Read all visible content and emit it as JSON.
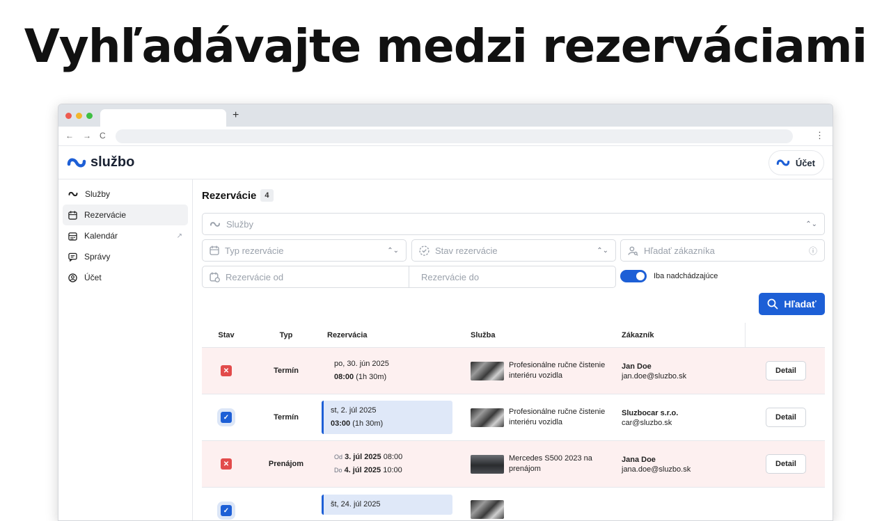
{
  "headline": "Vyhľadávajte medzi rezerváciami",
  "browser": {
    "new_tab": "+",
    "menu": "⋮",
    "nav_back": "←",
    "nav_forward": "→",
    "nav_reload": "C"
  },
  "app": {
    "brand": "službo",
    "account_label": "Účet",
    "brand_color": "#1d5fd6"
  },
  "sidebar": {
    "items": [
      {
        "label": "Služby",
        "icon": "wave-icon"
      },
      {
        "label": "Rezervácie",
        "icon": "calendar-icon",
        "active": true
      },
      {
        "label": "Kalendár",
        "icon": "calendar-grid-icon",
        "external": true
      },
      {
        "label": "Správy",
        "icon": "message-icon"
      },
      {
        "label": "Účet",
        "icon": "user-circle-icon"
      }
    ]
  },
  "main": {
    "title": "Rezervácie",
    "count": "4",
    "filters": {
      "services_placeholder": "Služby",
      "type_placeholder": "Typ rezervácie",
      "status_placeholder": "Stav rezervácie",
      "customer_placeholder": "Hľadať zákazníka",
      "from_placeholder": "Rezervácie od",
      "to_placeholder": "Rezervácie do",
      "upcoming_label": "Iba nadchádzajúce",
      "upcoming_on": true,
      "search_label": "Hľadať"
    },
    "table": {
      "headers": {
        "stav": "Stav",
        "typ": "Typ",
        "rezervacia": "Rezervácia",
        "sluzba": "Služba",
        "zakaznik": "Zákazník"
      },
      "detail_label": "Detail",
      "rows": [
        {
          "status": "cancelled",
          "type": "Termín",
          "date": "po, 30. jún 2025",
          "time": "08:00",
          "duration": "(1h 30m)",
          "service": "Profesionálne ručne čistenie interiéru vozidla",
          "customer": "Jan Doe",
          "email": "jan.doe@sluzbo.sk"
        },
        {
          "status": "confirmed",
          "type": "Termín",
          "date": "st, 2. júl 2025",
          "time": "03:00",
          "duration": "(1h 30m)",
          "service": "Profesionálne ručne čistenie interiéru vozidla",
          "customer": "Sluzbocar s.r.o.",
          "email": "car@sluzbo.sk"
        },
        {
          "status": "cancelled",
          "type": "Prenájom",
          "from_prefix": "Od",
          "from_date": "3. júl 2025",
          "from_time": "08:00",
          "to_prefix": "Do",
          "to_date": "4. júl 2025",
          "to_time": "10:00",
          "service": "Mercedes S500 2023 na prenájom",
          "customer": "Jana Doe",
          "email": "jana.doe@sluzbo.sk"
        },
        {
          "status": "confirmed",
          "type": "",
          "date": "št, 24. júl 2025",
          "time": "",
          "duration": "",
          "service": "",
          "customer": "",
          "email": ""
        }
      ]
    }
  }
}
